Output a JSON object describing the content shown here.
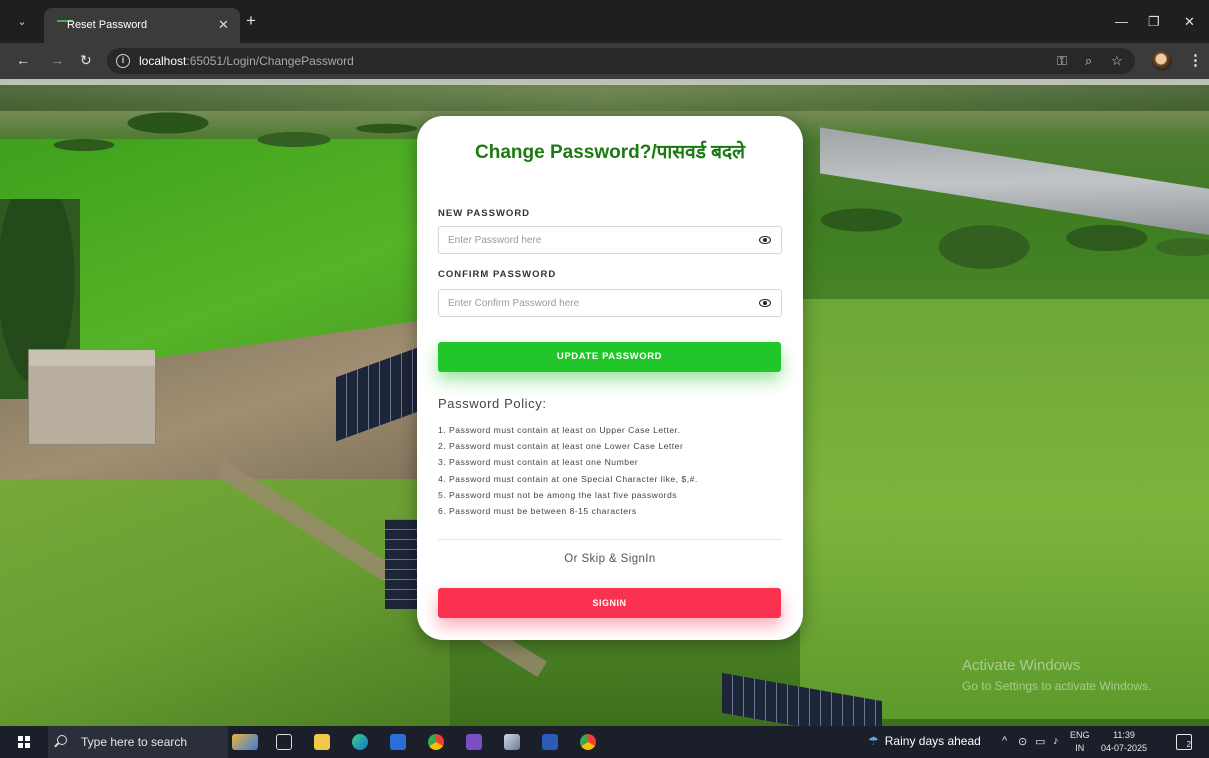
{
  "browser": {
    "tab_title": "Reset Password",
    "url_host": "localhost",
    "url_rest": ":65051/Login/ChangePassword"
  },
  "card": {
    "title": "Change Password?/पासवर्ड बदले",
    "new_password": {
      "label": "NEW PASSWORD",
      "placeholder": "Enter Password here"
    },
    "confirm_password": {
      "label": "CONFIRM PASSWORD",
      "placeholder": "Enter Confirm Password here"
    },
    "update_button": "UPDATE PASSWORD",
    "policy_heading": "Password Policy:",
    "policy_items": [
      "1. Password must contain at least on Upper Case Letter.",
      "2. Password must contain at least one Lower Case Letter",
      "3. Password must contain at least one Number",
      "4. Password must contain at one Special Character like, $,#.",
      "5. Password must not be among the last five passwords",
      "6. Password must be between 8-15 characters"
    ],
    "skip_text": "Or Skip & SignIn",
    "signin_button": "SIGNIN"
  },
  "watermark": {
    "line1": "Activate Windows",
    "line2": "Go to Settings to activate Windows."
  },
  "taskbar": {
    "search_placeholder": "Type here to search",
    "weather": "Rainy days ahead",
    "lang_top": "ENG",
    "lang_bottom": "IN",
    "time": "11:39",
    "date": "04-07-2025",
    "notification_count": "2"
  },
  "colors": {
    "title_green": "#1b7a10",
    "update_green": "#22c52a",
    "signin_red": "#fb324f"
  },
  "icons": {
    "password_toggle": "eye-icon",
    "taskbar_apps": [
      "widgets-icon",
      "task-view-icon",
      "file-explorer-icon",
      "edge-icon",
      "store-icon",
      "chrome-icon",
      "visual-studio-icon",
      "app-icon",
      "word-icon",
      "paint-icon"
    ]
  }
}
